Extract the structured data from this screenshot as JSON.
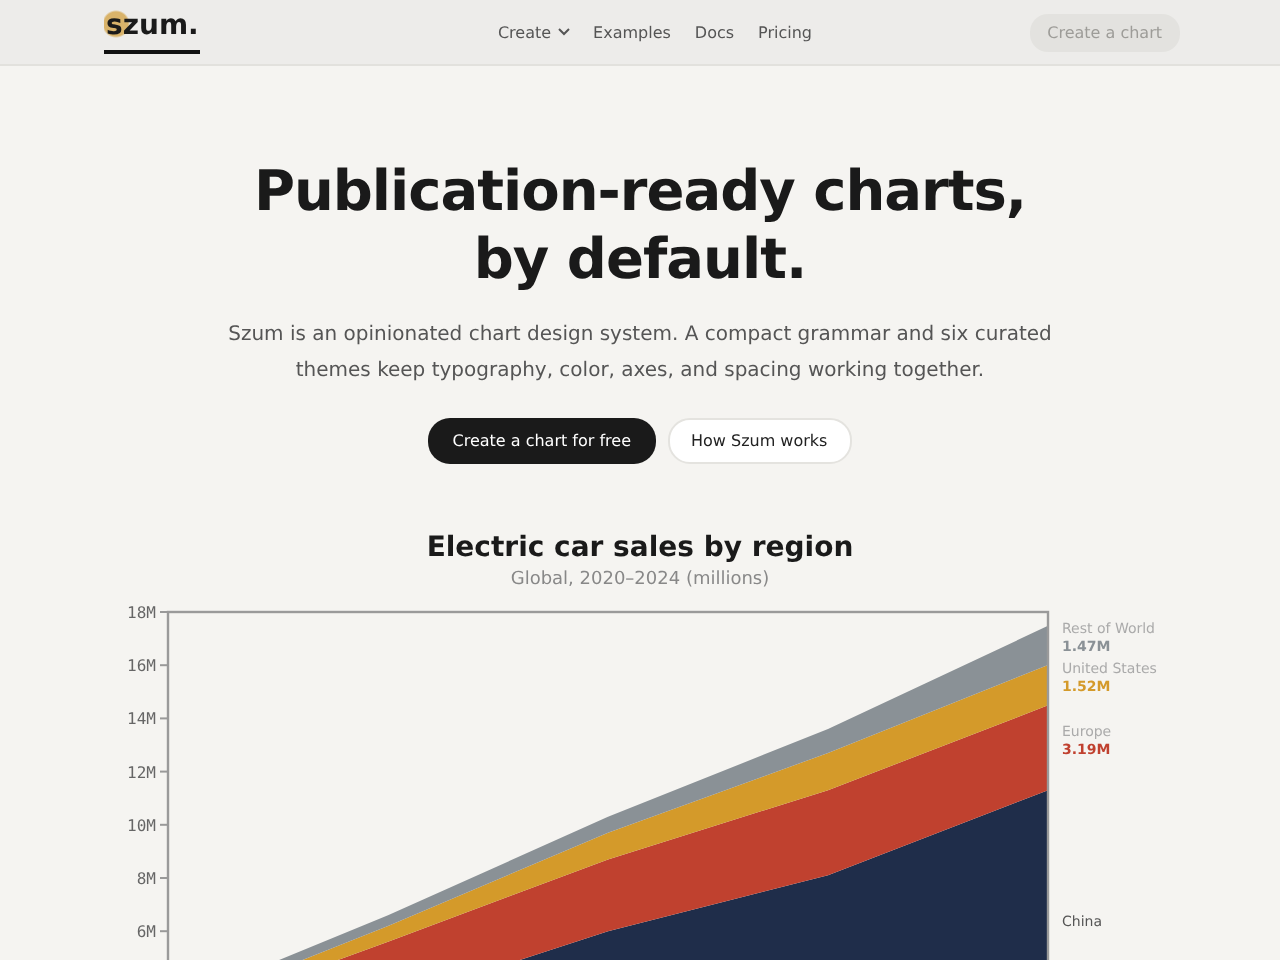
{
  "nav": {
    "logo": "szum.",
    "links": [
      {
        "label": "Create",
        "has_menu": true
      },
      {
        "label": "Examples",
        "has_menu": false
      },
      {
        "label": "Docs",
        "has_menu": false
      },
      {
        "label": "Pricing",
        "has_menu": false
      }
    ],
    "cta": "Create a chart"
  },
  "hero": {
    "title_lines": [
      "Publication-ready charts,",
      "by default."
    ],
    "subtitle": "Szum is an opinionated chart design system. A compact grammar and six curated themes keep typography, color, axes, and spacing working together.",
    "buttons": [
      {
        "label": "Create a chart for free",
        "kind": "primary"
      },
      {
        "label": "How Szum works",
        "kind": "secondary"
      }
    ]
  },
  "chart": {
    "chart_data": {
      "type": "area",
      "stacked": true,
      "title": "Electric car sales by region",
      "subtitle": "Global, 2020–2024 (millions)",
      "ylim": [
        0,
        18
      ],
      "yticks": [
        {
          "value": 6,
          "label": "6M"
        },
        {
          "value": 8,
          "label": "8M"
        },
        {
          "value": 10,
          "label": "10M"
        },
        {
          "value": 12,
          "label": "12M"
        },
        {
          "value": 14,
          "label": "14M"
        },
        {
          "value": 16,
          "label": "16M"
        },
        {
          "value": 18,
          "label": "18M"
        }
      ],
      "series": [
        {
          "name": "China",
          "color": "#1f2d4a",
          "values": [
            1.2,
            3.3,
            6.0,
            8.1,
            11.3
          ]
        },
        {
          "name": "Europe",
          "color": "#c0412f",
          "values": [
            1.4,
            2.3,
            2.7,
            3.2,
            3.19
          ]
        },
        {
          "name": "United States",
          "color": "#d49a2a",
          "values": [
            0.3,
            0.6,
            1.0,
            1.4,
            1.52
          ]
        },
        {
          "name": "Rest of World",
          "color": "#8a9196",
          "values": [
            0.3,
            0.4,
            0.6,
            0.9,
            1.47
          ]
        }
      ],
      "annotations": [
        "3.19M",
        "1.52M",
        "1.47M"
      ]
    }
  }
}
